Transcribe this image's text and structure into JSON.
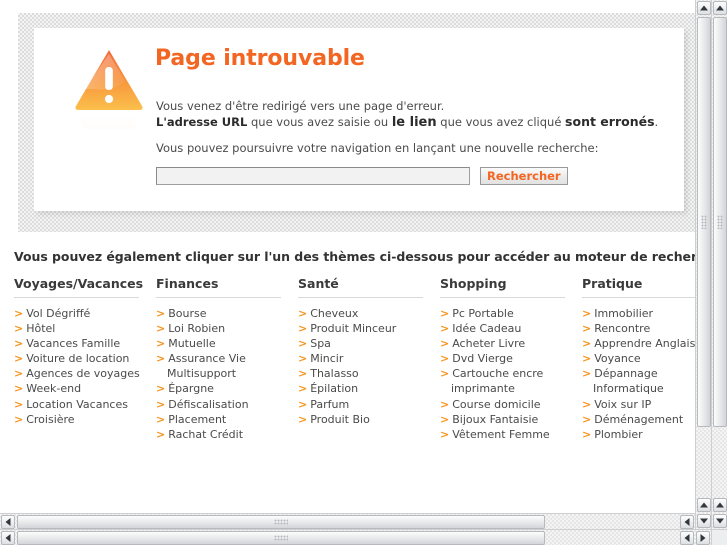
{
  "error_panel": {
    "icon": "warning-triangle-icon",
    "title": "Page introuvable",
    "line1": "Vous venez d'être redirigé vers une page d'erreur.",
    "line2_part1": "L'adresse URL",
    "line2_part2": " que vous avez saisie ou ",
    "line2_part3": "le lien",
    "line2_part4": " que vous avez cliqué ",
    "line2_part5": "sont erronés",
    "line2_part6": ".",
    "prompt": "Vous pouvez poursuivre votre navigation en lançant une nouvelle recherche:",
    "search_value": "",
    "search_placeholder": "",
    "search_button": "Rechercher"
  },
  "themes": {
    "heading": "Vous pouvez également cliquer sur l'un des thèmes ci-dessous pour accéder au moteur de recherche :",
    "arrow": ">",
    "columns": [
      {
        "title": "Voyages/Vacances",
        "links": [
          "Vol Dégriffé",
          "Hôtel",
          "Vacances Famille",
          "Voiture de location",
          "Agences de voyages",
          "Week-end",
          "Location Vacances",
          "Croisière"
        ]
      },
      {
        "title": "Finances",
        "links": [
          "Bourse",
          "Loi Robien",
          "Mutuelle",
          "Assurance Vie Multisupport",
          "Épargne",
          "Défiscalisation",
          "Placement",
          "Rachat Crédit"
        ]
      },
      {
        "title": "Santé",
        "links": [
          "Cheveux",
          "Produit Minceur",
          "Spa",
          "Mincir",
          "Thalasso",
          "Épilation",
          "Parfum",
          "Produit Bio"
        ]
      },
      {
        "title": "Shopping",
        "links": [
          "Pc Portable",
          "Idée Cadeau",
          "Acheter Livre",
          "Dvd Vierge",
          "Cartouche encre imprimante",
          "Course domicile",
          "Bijoux Fantaisie",
          "Vêtement Femme"
        ]
      },
      {
        "title": "Pratique",
        "links": [
          "Immobilier",
          "Rencontre",
          "Apprendre Anglais",
          "Voyance",
          "Dépannage Informatique",
          "Voix sur IP",
          "Déménagement",
          "Plombier"
        ]
      }
    ]
  },
  "colors": {
    "accent_orange": "#f26522",
    "arrow_orange": "#f7941e",
    "link_text": "#4a4a4a",
    "heading_text": "#333333"
  },
  "scrollbars": {
    "vertical_up": "scroll-up-icon",
    "vertical_down": "scroll-down-icon",
    "horizontal_left": "scroll-left-icon",
    "horizontal_right": "scroll-right-icon"
  }
}
